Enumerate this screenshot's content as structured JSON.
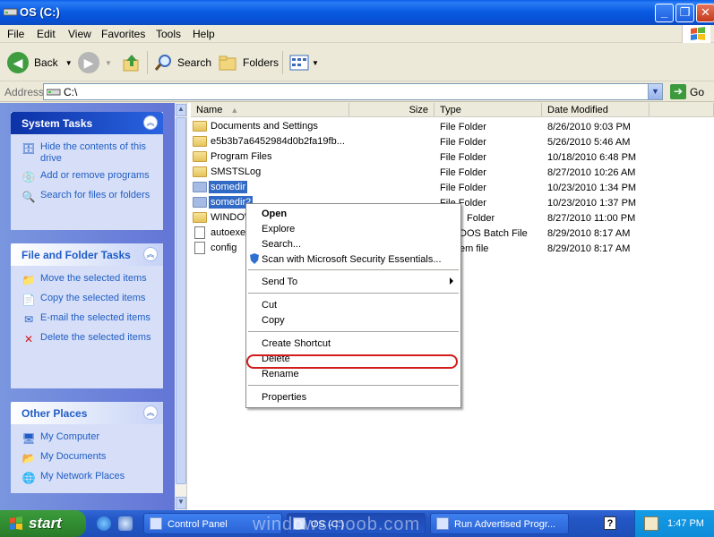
{
  "window": {
    "title": "OS (C:)"
  },
  "menu": [
    "File",
    "Edit",
    "View",
    "Favorites",
    "Tools",
    "Help"
  ],
  "toolbar": {
    "back": "Back",
    "search": "Search",
    "folders": "Folders"
  },
  "address": {
    "label": "Address",
    "value": "C:\\",
    "go": "Go"
  },
  "panels": {
    "system_tasks": {
      "title": "System Tasks",
      "items": [
        {
          "label": "Hide the contents of this drive",
          "icon": "hide-drive-icon"
        },
        {
          "label": "Add or remove programs",
          "icon": "add-remove-icon"
        },
        {
          "label": "Search for files or folders",
          "icon": "search-icon"
        }
      ]
    },
    "file_tasks": {
      "title": "File and Folder Tasks",
      "items": [
        {
          "label": "Move the selected items",
          "icon": "move-icon"
        },
        {
          "label": "Copy the selected items",
          "icon": "copy-icon"
        },
        {
          "label": "E-mail the selected items",
          "icon": "email-icon"
        },
        {
          "label": "Delete the selected items",
          "icon": "delete-icon"
        }
      ]
    },
    "other_places": {
      "title": "Other Places",
      "items": [
        {
          "label": "My Computer",
          "icon": "computer-icon"
        },
        {
          "label": "My Documents",
          "icon": "documents-icon"
        },
        {
          "label": "My Network Places",
          "icon": "network-icon"
        }
      ]
    }
  },
  "columns": {
    "name": "Name",
    "size": "Size",
    "type": "Type",
    "date": "Date Modified"
  },
  "files": [
    {
      "name": "Documents and Settings",
      "type": "File Folder",
      "date": "8/26/2010 9:03 PM",
      "kind": "folder"
    },
    {
      "name": "e5b3b7a6452984d0b2fa19fb...",
      "type": "File Folder",
      "date": "5/26/2010 5:46 AM",
      "kind": "folder"
    },
    {
      "name": "Program Files",
      "type": "File Folder",
      "date": "10/18/2010 6:48 PM",
      "kind": "folder"
    },
    {
      "name": "SMSTSLog",
      "type": "File Folder",
      "date": "8/27/2010 10:26 AM",
      "kind": "folder"
    },
    {
      "name": "somedir",
      "type": "File Folder",
      "date": "10/23/2010 1:34 PM",
      "kind": "folder",
      "selected": true
    },
    {
      "name": "somedir2",
      "type": "File Folder",
      "date": "10/23/2010 1:37 PM",
      "kind": "folder",
      "selected": true
    },
    {
      "name": "WINDOWS",
      "type": "File Folder",
      "date": "8/27/2010 11:00 PM",
      "kind": "folder"
    },
    {
      "name": "autoexec",
      "type": "MS-DOS Batch File",
      "date": "8/29/2010 8:17 AM",
      "kind": "file"
    },
    {
      "name": "config",
      "type": "System file",
      "date": "8/29/2010 8:17 AM",
      "kind": "file"
    }
  ],
  "visible_text": {
    "windows_name": "WINDOW",
    "autoexec_name": "autoexe",
    "somedir2_name": "somedir2",
    "row7_type": "Folder",
    "row8_type": "DOS Batch File",
    "row9_type": "em file"
  },
  "context_menu": {
    "open": "Open",
    "explore": "Explore",
    "search": "Search...",
    "scan": "Scan with Microsoft Security Essentials...",
    "send_to": "Send To",
    "cut": "Cut",
    "copy": "Copy",
    "create_shortcut": "Create Shortcut",
    "delete": "Delete",
    "rename": "Rename",
    "properties": "Properties",
    "highlight_color": "#d21b1b"
  },
  "taskbar": {
    "start": "start",
    "items": [
      "Control Panel",
      "OS (C:)",
      "Run Advertised Progr..."
    ],
    "clock": "1:47 PM",
    "watermark": "windows-noob.com"
  }
}
